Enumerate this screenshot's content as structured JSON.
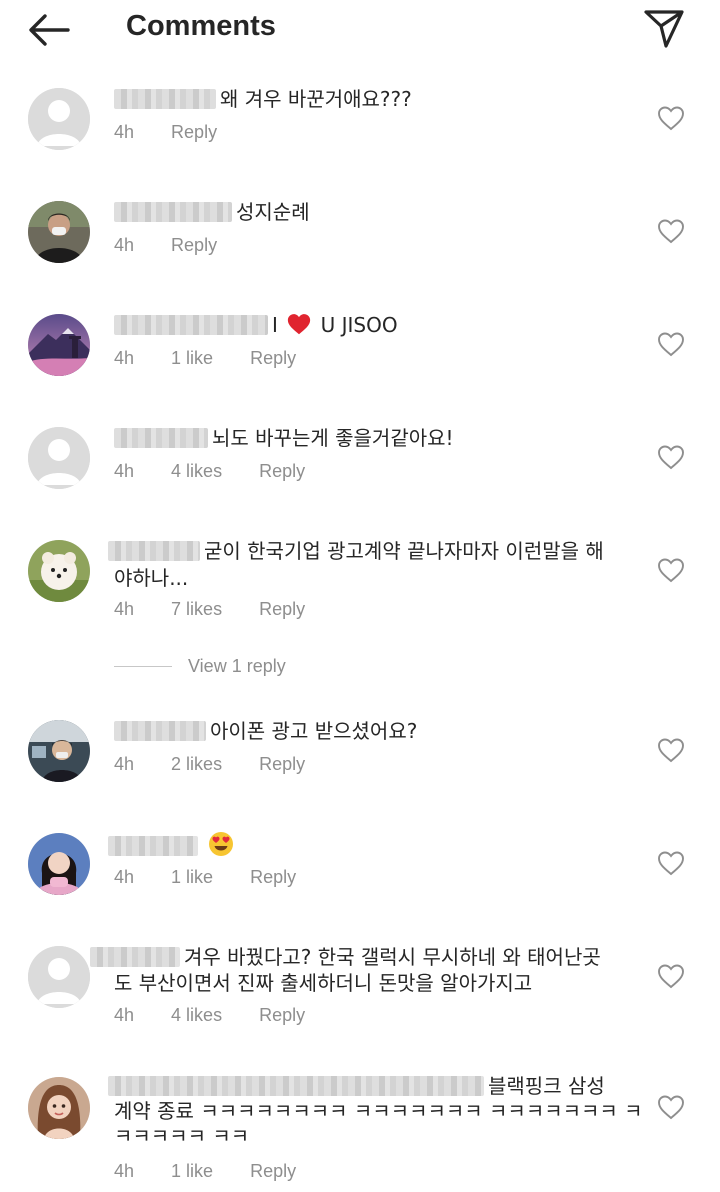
{
  "header": {
    "title": "Comments",
    "back_icon": "arrow-left-icon",
    "send_icon": "paper-plane-icon"
  },
  "comments": [
    {
      "text": "왜 겨우 바꾼거애요???",
      "time": "4h",
      "likes": "",
      "reply": "Reply"
    },
    {
      "text": "성지순례",
      "time": "4h",
      "likes": "",
      "reply": "Reply"
    },
    {
      "text_before": "I",
      "text_after": "U JISOO",
      "time": "4h",
      "likes": "1 like",
      "reply": "Reply"
    },
    {
      "text": "뇌도 바꾸는게 좋을거같아요!",
      "time": "4h",
      "likes": "4 likes",
      "reply": "Reply"
    },
    {
      "text_line1": "굳이 한국기업 광고계약 끝나자마자 이런말을 해",
      "text_line2": "야하나...",
      "time": "4h",
      "likes": "7 likes",
      "reply": "Reply"
    },
    {
      "text": "아이폰 광고 받으셨어요?",
      "time": "4h",
      "likes": "2 likes",
      "reply": "Reply"
    },
    {
      "emoji": "heart-eyes-emoji",
      "time": "4h",
      "likes": "1 like",
      "reply": "Reply"
    },
    {
      "text_line1": "겨우 바꿨다고? 한국 갤럭시 무시하네 와 태어난곳",
      "text_line2": "도 부산이면서 진짜 출세하더니 돈맛을 알아가지고",
      "time": "4h",
      "likes": "4 likes",
      "reply": "Reply"
    },
    {
      "text_line1": "블랙핑크 삼성",
      "text_line2": "계약 종료 ㅋㅋㅋㅋㅋㅋㅋㅋ ㅋㅋㅋㅋㅋㅋㅋ ㅋㅋㅋㅋㅋㅋㅋ ㅋ",
      "text_line3": "ㅋㅋㅋㅋㅋ ㅋㅋ",
      "time": "4h",
      "likes": "1 like",
      "reply": "Reply"
    }
  ],
  "view_replies": "View 1 reply",
  "colors": {
    "text": "#262626",
    "meta": "#8e8e8e",
    "heart_red": "#ed4956",
    "avatar_placeholder": "#dbdbdb"
  }
}
